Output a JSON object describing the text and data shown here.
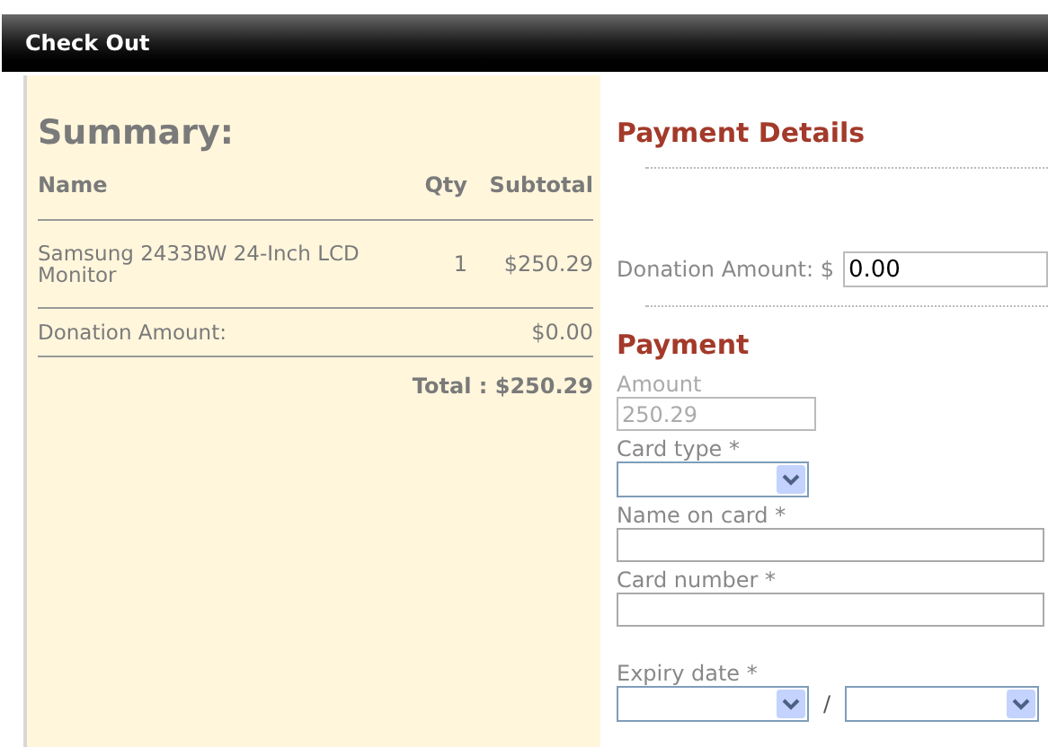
{
  "header": {
    "title": "Check Out"
  },
  "summary": {
    "title": "Summary:",
    "columns": [
      "Name",
      "Qty",
      "Subtotal"
    ],
    "rows": [
      {
        "name": "Samsung 2433BW 24-Inch LCD Monitor",
        "qty": "1",
        "subtotal": "$250.29"
      },
      {
        "name": "Donation Amount:",
        "qty": "",
        "subtotal": "$0.00"
      }
    ],
    "total": "Total : $250.29"
  },
  "payment_details": {
    "title": "Payment Details",
    "donation_label": "Donation Amount: $",
    "donation_value": "0.00"
  },
  "payment": {
    "title": "Payment",
    "fields": [
      {
        "kind": "text",
        "label": "Amount",
        "value": "250.29",
        "disabled": true
      },
      {
        "kind": "select",
        "label": "Card type *"
      },
      {
        "kind": "text",
        "label": "Name on card *",
        "disabled": false
      },
      {
        "kind": "text",
        "label": "Card number *",
        "disabled": false
      },
      {
        "kind": "expiry",
        "label": "Expiry date *",
        "separator": "/"
      }
    ]
  }
}
